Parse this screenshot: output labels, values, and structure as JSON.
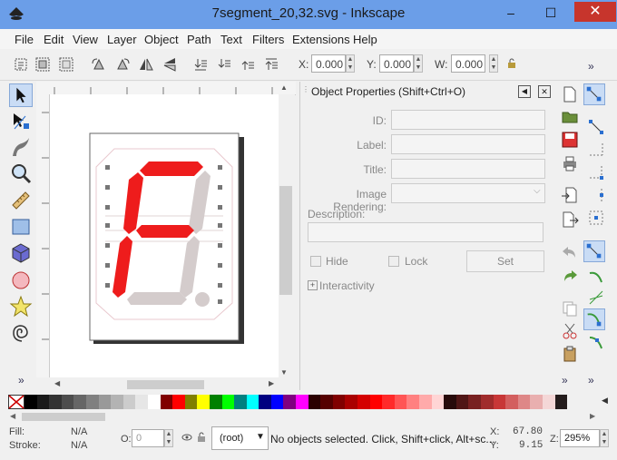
{
  "window": {
    "title": "7segment_20,32.svg - Inkscape",
    "minimize": "–",
    "maximize": "☐",
    "close": "✕"
  },
  "menu": [
    "File",
    "Edit",
    "View",
    "Layer",
    "Object",
    "Path",
    "Text",
    "Filters",
    "Extensions",
    "Help"
  ],
  "toolbar": {
    "x_label": "X:",
    "x_value": "0.000",
    "y_label": "Y:",
    "y_value": "0.000",
    "w_label": "W:",
    "w_value": "0.000",
    "overflow": "»"
  },
  "toolbox": {
    "tools": [
      "selector-tool-icon",
      "node-tool-icon",
      "tweak-tool-icon",
      "zoom-tool-icon",
      "measure-tool-icon",
      "rectangle-tool-icon",
      "3d-box-tool-icon",
      "ellipse-tool-icon",
      "star-tool-icon",
      "spiral-tool-icon"
    ],
    "overflow": "»"
  },
  "drawing": {
    "lit_color": "#ee1c1c",
    "unlit_color": "#d4cccc",
    "lit_segments": [
      "a",
      "f",
      "e",
      "g"
    ]
  },
  "object_properties": {
    "title": "Object Properties (Shift+Ctrl+O)",
    "id_label": "ID:",
    "label_label": "Label:",
    "title_label": "Title:",
    "image_rendering_label": "Image Rendering:",
    "description_label": "Description:",
    "hide_label": "Hide",
    "lock_label": "Lock",
    "set_button": "Set",
    "interactivity_label": "Interactivity",
    "expander": "+"
  },
  "commands_bar": {
    "overflow": "»"
  },
  "palette": {
    "none_swatch": "none",
    "colors": [
      "#000000",
      "#1a1a1a",
      "#333333",
      "#4d4d4d",
      "#666666",
      "#808080",
      "#999999",
      "#b3b3b3",
      "#cccccc",
      "#e6e6e6",
      "#ffffff",
      "#800000",
      "#ff0000",
      "#808000",
      "#ffff00",
      "#008000",
      "#00ff00",
      "#008080",
      "#00ffff",
      "#000080",
      "#0000ff",
      "#800080",
      "#ff00ff",
      "#2b0000",
      "#550000",
      "#800000",
      "#aa0000",
      "#d40000",
      "#ff0000",
      "#ff2a2a",
      "#ff5555",
      "#ff8080",
      "#ffaaaa",
      "#ffd5d5",
      "#280b0b",
      "#501616",
      "#782121",
      "#a02c2c",
      "#c83737",
      "#d35f5f",
      "#de8787",
      "#e9afaf",
      "#f4d7d7",
      "#241c1c"
    ]
  },
  "status": {
    "fill_label": "Fill:",
    "fill_value": "N/A",
    "stroke_label": "Stroke:",
    "stroke_value": "N/A",
    "opacity_label": "O:",
    "opacity_value": "0",
    "layer_value": "(root)",
    "message": "No objects selected. Click, Shift+click, Alt+sc...",
    "x_label": "X:",
    "x_value": "67.80",
    "y_label": "Y:",
    "y_value": "9.15",
    "zoom_label": "Z:",
    "zoom_value": "295%"
  }
}
